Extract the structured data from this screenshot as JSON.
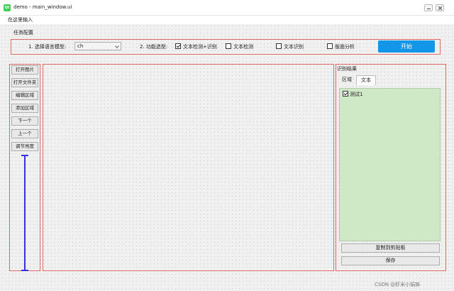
{
  "window": {
    "title": "demo - main_window.ui",
    "app_icon_text": "Qt"
  },
  "menubar": {
    "placeholder": "在这里输入"
  },
  "task": {
    "section_label": "任务配置",
    "model_label": "1. 选择语言模型:",
    "model_value": "ch",
    "feature_label": "2. 功能选型:",
    "options": [
      {
        "label": "文本检测+识别",
        "checked": true
      },
      {
        "label": "文本检测",
        "checked": false
      },
      {
        "label": "文本识别",
        "checked": false
      },
      {
        "label": "版面分析",
        "checked": false
      }
    ],
    "start_label": "开始"
  },
  "sidebar": {
    "buttons": [
      "打开图片",
      "打开文件夹",
      "编辑区域",
      "添加区域",
      "下一个",
      "上一个",
      "调节亮度"
    ],
    "brightness_slider_color": "#3333dd"
  },
  "results": {
    "title": "识别结果",
    "tabs": [
      "区域",
      "文本"
    ],
    "active_tab": "文本",
    "items": [
      {
        "label": "测试1",
        "checked": true
      }
    ],
    "copy_label": "复制到剪贴板",
    "save_label": "保存"
  },
  "colors": {
    "accent_button": "#1296e8",
    "result_area": "#cfe8c6",
    "layout_border": "#e06a6a"
  },
  "watermark": "CSDN @虾米小娟姊"
}
